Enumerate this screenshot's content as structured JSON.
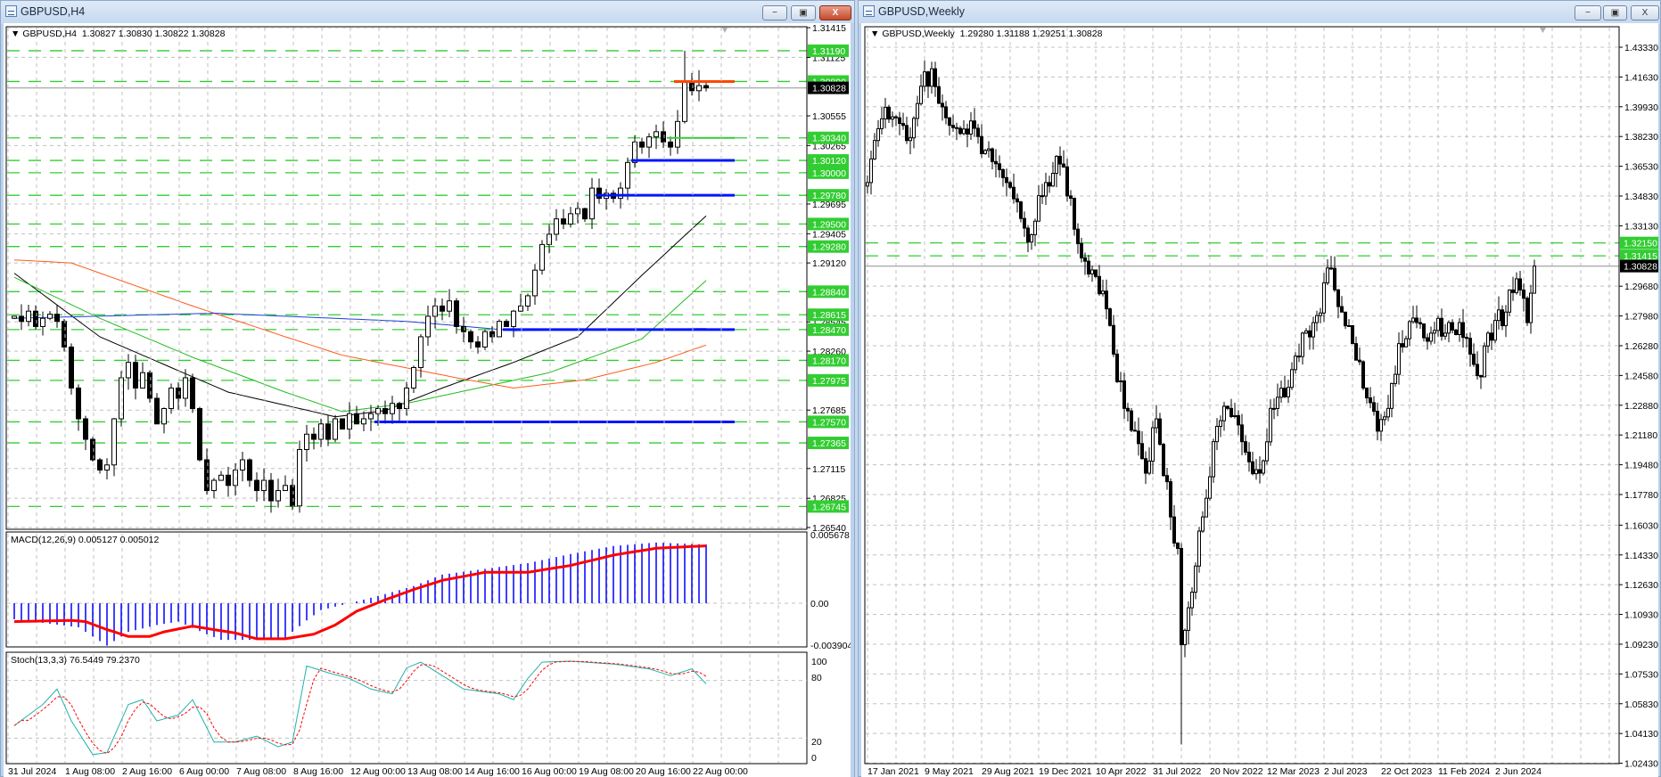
{
  "colors": {
    "level_green": "#32cd32",
    "ma_black": "#000000",
    "ma_green": "#22bb22",
    "ma_red": "#ff5a1f",
    "ma_blue": "#1f3fd6",
    "segment_blue": "#0014ff",
    "segment_orange": "#ff4500",
    "macd_hist": "#0000ff",
    "macd_signal": "#ff0000",
    "stoch_main": "#20b2aa",
    "stoch_signal": "#ff0000",
    "current_tag": "#000000"
  },
  "h4": {
    "title": "GBPUSD,H4",
    "legend_symbol": "GBPUSD,H4",
    "legend_ohlc": "1.30827 1.30830 1.30822 1.30828",
    "buttons": {
      "minimize": "−",
      "restore": "▣",
      "close": "X"
    },
    "price_axis": [
      "1.31415",
      "1.31125",
      "1.30555",
      "1.30265",
      "1.29695",
      "1.29405",
      "1.29120",
      "1.28545",
      "1.28260",
      "1.27685",
      "1.27115",
      "1.26825",
      "1.26540"
    ],
    "levels": [
      "1.31190",
      "1.30890",
      "1.30340",
      "1.30120",
      "1.30000",
      "1.29780",
      "1.29500",
      "1.29280",
      "1.28840",
      "1.28615",
      "1.28470",
      "1.28170",
      "1.27975",
      "1.27570",
      "1.27365",
      "1.26745"
    ],
    "current_price": "1.30828",
    "time_labels": [
      "31 Jul 2024",
      "1 Aug 08:00",
      "2 Aug 16:00",
      "6 Aug 00:00",
      "7 Aug 08:00",
      "8 Aug 16:00",
      "12 Aug 00:00",
      "13 Aug 08:00",
      "14 Aug 16:00",
      "16 Aug 00:00",
      "19 Aug 08:00",
      "20 Aug 16:00",
      "22 Aug 00:00"
    ],
    "first_open": 1.2858,
    "closes": [
      1.286,
      1.2855,
      1.2865,
      1.285,
      1.2858,
      1.2862,
      1.2855,
      1.283,
      1.279,
      1.276,
      1.274,
      1.272,
      1.271,
      1.2715,
      1.276,
      1.28,
      1.2815,
      1.279,
      1.2805,
      1.278,
      1.2755,
      1.277,
      1.279,
      1.278,
      1.28,
      1.277,
      1.272,
      1.269,
      1.27,
      1.2705,
      1.2695,
      1.271,
      1.272,
      1.27,
      1.269,
      1.27,
      1.268,
      1.269,
      1.2695,
      1.2675,
      1.273,
      1.2745,
      1.274,
      1.2755,
      1.274,
      1.276,
      1.275,
      1.2765,
      1.2755,
      1.276,
      1.2765,
      1.277,
      1.2765,
      1.2775,
      1.277,
      1.279,
      1.281,
      1.284,
      1.286,
      1.287,
      1.2865,
      1.2875,
      1.285,
      1.2845,
      1.2835,
      1.283,
      1.2845,
      1.284,
      1.2855,
      1.285,
      1.2865,
      1.287,
      1.288,
      1.2905,
      1.293,
      1.294,
      1.2955,
      1.295,
      1.296,
      1.2965,
      1.2955,
      1.2985,
      1.2975,
      1.298,
      1.2975,
      1.2985,
      1.301,
      1.303,
      1.3025,
      1.3035,
      1.304,
      1.303,
      1.3025,
      1.305,
      1.3089,
      1.308,
      1.3085,
      1.30828
    ],
    "high_overrides": {
      "94": 1.3119,
      "96": 1.31
    },
    "ma_lines": [
      {
        "name": "ma-black",
        "color": "#000000",
        "anchors": [
          [
            0,
            1.2902
          ],
          [
            12,
            1.284
          ],
          [
            30,
            1.2786
          ],
          [
            45,
            1.2762
          ],
          [
            52,
            1.2768
          ],
          [
            60,
            1.279
          ],
          [
            70,
            1.2815
          ],
          [
            79,
            1.284
          ],
          [
            88,
            1.29
          ],
          [
            97,
            1.2958
          ]
        ]
      },
      {
        "name": "ma-green",
        "color": "#22bb22",
        "anchors": [
          [
            0,
            1.2898
          ],
          [
            12,
            1.2858
          ],
          [
            25,
            1.282
          ],
          [
            38,
            1.2786
          ],
          [
            46,
            1.2767
          ],
          [
            55,
            1.2775
          ],
          [
            65,
            1.279
          ],
          [
            75,
            1.2805
          ],
          [
            88,
            1.2838
          ],
          [
            97,
            1.2895
          ]
        ]
      },
      {
        "name": "ma-red",
        "color": "#ff5a1f",
        "anchors": [
          [
            0,
            1.2915
          ],
          [
            8,
            1.2912
          ],
          [
            25,
            1.287
          ],
          [
            38,
            1.284
          ],
          [
            46,
            1.2822
          ],
          [
            62,
            1.28
          ],
          [
            70,
            1.279
          ],
          [
            80,
            1.2798
          ],
          [
            90,
            1.2815
          ],
          [
            97,
            1.2832
          ]
        ]
      },
      {
        "name": "ma-blue",
        "color": "#1f3fd6",
        "anchors": [
          [
            0,
            1.2858
          ],
          [
            28,
            1.2863
          ],
          [
            55,
            1.2855
          ],
          [
            70,
            1.2846
          ],
          [
            97,
            1.2848
          ]
        ]
      }
    ],
    "segments": [
      {
        "price": 1.3089,
        "color": "#ff4500",
        "from": 93,
        "to": 101,
        "width": 3
      },
      {
        "price": 1.3034,
        "color": "#32cd32",
        "from": 92,
        "to": 101,
        "width": 2
      },
      {
        "price": 1.3012,
        "color": "#0014ff",
        "from": 87,
        "to": 101,
        "width": 3
      },
      {
        "price": 1.2978,
        "color": "#0014ff",
        "from": 82,
        "to": 101,
        "width": 3
      },
      {
        "price": 1.2847,
        "color": "#0014ff",
        "from": 69,
        "to": 101,
        "width": 3
      },
      {
        "price": 1.2757,
        "color": "#0014ff",
        "from": 51,
        "to": 101,
        "width": 3
      }
    ],
    "macd": {
      "label": "MACD(12,26,9) 0.005127 0.005012",
      "axis": [
        "0.005678",
        "0.00",
        "-0.003904"
      ],
      "hist": [
        [
          0,
          -0.0014
        ],
        [
          9,
          -0.0021
        ],
        [
          13,
          -0.0037
        ],
        [
          16,
          -0.0025
        ],
        [
          20,
          -0.0019
        ],
        [
          23,
          -0.0016
        ],
        [
          27,
          -0.0027
        ],
        [
          29,
          -0.0032
        ],
        [
          35,
          -0.0032
        ],
        [
          38,
          -0.003
        ],
        [
          41,
          -0.0015
        ],
        [
          43,
          -0.0006
        ],
        [
          47,
          0.0
        ],
        [
          52,
          0.0008
        ],
        [
          56,
          0.0015
        ],
        [
          60,
          0.0025
        ],
        [
          66,
          0.003
        ],
        [
          72,
          0.0035
        ],
        [
          78,
          0.0043
        ],
        [
          84,
          0.005
        ],
        [
          90,
          0.0053
        ],
        [
          97,
          0.005127
        ]
      ],
      "signal": [
        [
          0,
          -0.0016
        ],
        [
          8,
          -0.0015
        ],
        [
          10,
          -0.0016
        ],
        [
          13,
          -0.0023
        ],
        [
          16,
          -0.0029
        ],
        [
          19,
          -0.0029
        ],
        [
          21,
          -0.0025
        ],
        [
          25,
          -0.002
        ],
        [
          28,
          -0.0023
        ],
        [
          31,
          -0.0026
        ],
        [
          34,
          -0.0031
        ],
        [
          38,
          -0.0031
        ],
        [
          42,
          -0.0027
        ],
        [
          45,
          -0.0019
        ],
        [
          48,
          -0.0007
        ],
        [
          52,
          0.0003
        ],
        [
          56,
          0.0012
        ],
        [
          60,
          0.002
        ],
        [
          66,
          0.0027
        ],
        [
          72,
          0.0027
        ],
        [
          78,
          0.0033
        ],
        [
          84,
          0.0042
        ],
        [
          90,
          0.0048
        ],
        [
          97,
          0.005012
        ]
      ]
    },
    "stoch": {
      "label": "Stoch(13,3,3) 76.5449 79.2370",
      "axis": [
        "100",
        "80",
        "20",
        "0"
      ],
      "main": [
        [
          0,
          33
        ],
        [
          4,
          55
        ],
        [
          6,
          71
        ],
        [
          8,
          38
        ],
        [
          11,
          3
        ],
        [
          13,
          5
        ],
        [
          16,
          55
        ],
        [
          18,
          60
        ],
        [
          20,
          38
        ],
        [
          23,
          44
        ],
        [
          25,
          60
        ],
        [
          28,
          16
        ],
        [
          31,
          16
        ],
        [
          34,
          22
        ],
        [
          37,
          11
        ],
        [
          39,
          16
        ],
        [
          41,
          95
        ],
        [
          44,
          88
        ],
        [
          47,
          82
        ],
        [
          50,
          71
        ],
        [
          53,
          66
        ],
        [
          55,
          93
        ],
        [
          57,
          99
        ],
        [
          60,
          85
        ],
        [
          63,
          71
        ],
        [
          68,
          66
        ],
        [
          70,
          60
        ],
        [
          72,
          82
        ],
        [
          74,
          99
        ],
        [
          78,
          100
        ],
        [
          84,
          97
        ],
        [
          89,
          92
        ],
        [
          92,
          85
        ],
        [
          95,
          92
        ],
        [
          97,
          76.5
        ]
      ]
    }
  },
  "weekly": {
    "title": "GBPUSD,Weekly",
    "legend_symbol": "GBPUSD,Weekly",
    "legend_ohlc": "1.29280 1.31188 1.29251 1.30828",
    "buttons": {
      "minimize": "−",
      "restore": "▣",
      "close": "X"
    },
    "price_axis": [
      "1.43330",
      "1.41630",
      "1.39930",
      "1.38230",
      "1.36530",
      "1.34830",
      "1.33130",
      "1.29680",
      "1.27980",
      "1.26280",
      "1.24580",
      "1.22880",
      "1.21180",
      "1.19480",
      "1.17780",
      "1.16030",
      "1.14330",
      "1.12630",
      "1.10930",
      "1.09230",
      "1.07530",
      "1.05830",
      "1.04130",
      "1.02430"
    ],
    "levels": [
      "1.32150",
      "1.31415"
    ],
    "current_price": "1.30828",
    "time_labels": [
      "17 Jan 2021",
      "9 May 2021",
      "29 Aug 2021",
      "19 Dec 2021",
      "10 Apr 2022",
      "31 Jul 2022",
      "20 Nov 2022",
      "12 Mar 2023",
      "2 Jul 2023",
      "22 Oct 2023",
      "11 Feb 2024",
      "2 Jun 2024"
    ],
    "anchors": [
      [
        0,
        1.356
      ],
      [
        2,
        1.38
      ],
      [
        5,
        1.399
      ],
      [
        8,
        1.393
      ],
      [
        11,
        1.38
      ],
      [
        15,
        1.411
      ],
      [
        18,
        1.421
      ],
      [
        22,
        1.393
      ],
      [
        26,
        1.384
      ],
      [
        30,
        1.387
      ],
      [
        35,
        1.368
      ],
      [
        39,
        1.356
      ],
      [
        45,
        1.322
      ],
      [
        50,
        1.356
      ],
      [
        53,
        1.371
      ],
      [
        57,
        1.347
      ],
      [
        60,
        1.313
      ],
      [
        66,
        1.294
      ],
      [
        69,
        1.258
      ],
      [
        72,
        1.227
      ],
      [
        75,
        1.214
      ],
      [
        78,
        1.19
      ],
      [
        81,
        1.221
      ],
      [
        85,
        1.165
      ],
      [
        87,
        1.147
      ],
      [
        88,
        1.092
      ],
      [
        91,
        1.122
      ],
      [
        94,
        1.165
      ],
      [
        97,
        1.208
      ],
      [
        101,
        1.227
      ],
      [
        106,
        1.202
      ],
      [
        110,
        1.19
      ],
      [
        113,
        1.227
      ],
      [
        118,
        1.239
      ],
      [
        122,
        1.27
      ],
      [
        125,
        1.276
      ],
      [
        130,
        1.307
      ],
      [
        133,
        1.282
      ],
      [
        136,
        1.264
      ],
      [
        140,
        1.233
      ],
      [
        143,
        1.214
      ],
      [
        146,
        1.227
      ],
      [
        149,
        1.264
      ],
      [
        154,
        1.276
      ],
      [
        158,
        1.27
      ],
      [
        163,
        1.276
      ],
      [
        166,
        1.276
      ],
      [
        169,
        1.258
      ],
      [
        172,
        1.245
      ],
      [
        174,
        1.27
      ],
      [
        179,
        1.282
      ],
      [
        182,
        1.301
      ],
      [
        185,
        1.276
      ],
      [
        186,
        1.2928
      ],
      [
        187,
        1.30828
      ]
    ],
    "high_overrides": {
      "18": 1.425,
      "130": 1.3142,
      "187": 1.31188
    },
    "low_overrides": {
      "88": 1.035,
      "187": 1.29251
    }
  }
}
